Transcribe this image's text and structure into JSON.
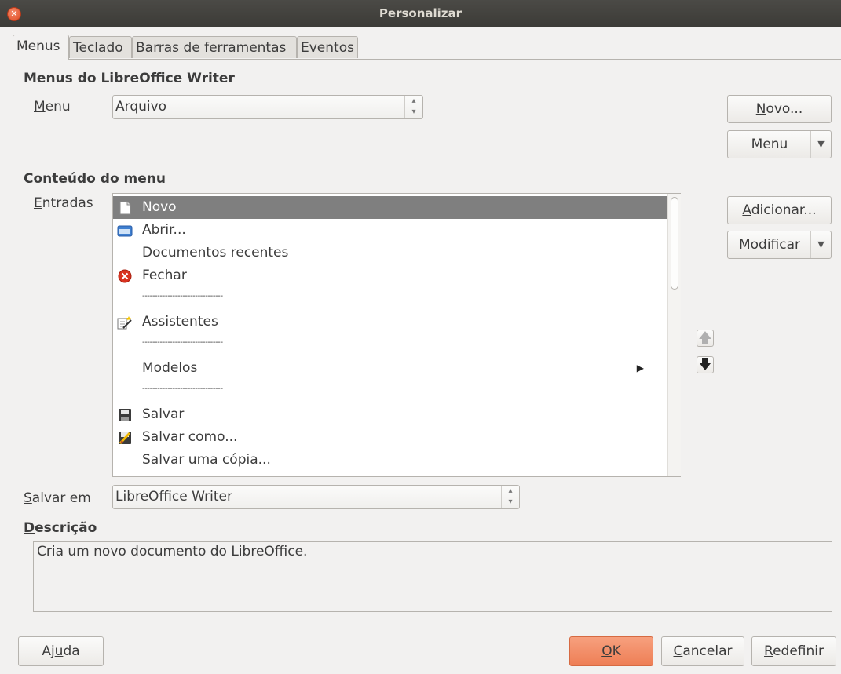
{
  "window": {
    "title": "Personalizar"
  },
  "tabs": [
    {
      "label": "Menus",
      "active": true
    },
    {
      "label": "Teclado",
      "active": false
    },
    {
      "label": "Barras de ferramentas",
      "active": false
    },
    {
      "label": "Eventos",
      "active": false
    }
  ],
  "menus_section": {
    "title": "Menus do LibreOffice Writer",
    "menu_label": "Menu",
    "menu_value": "Arquivo",
    "new_button": "Novo...",
    "menu_button": "Menu"
  },
  "content_section": {
    "title": "Conteúdo do menu",
    "entries_label": "Entradas",
    "entries": [
      {
        "label": "Novo",
        "icon": "new-document-icon",
        "selected": true
      },
      {
        "label": "Abrir...",
        "icon": "open-folder-icon"
      },
      {
        "label": "Documentos recentes",
        "icon": ""
      },
      {
        "label": "Fechar",
        "icon": "close-red-icon"
      },
      {
        "label": "--------------------------------",
        "icon": ""
      },
      {
        "label": "Assistentes",
        "icon": "wizard-icon"
      },
      {
        "label": "--------------------------------",
        "icon": ""
      },
      {
        "label": "Modelos",
        "icon": "",
        "submenu": true
      },
      {
        "label": "--------------------------------",
        "icon": ""
      },
      {
        "label": "Salvar",
        "icon": "save-icon"
      },
      {
        "label": "Salvar como...",
        "icon": "save-as-icon"
      },
      {
        "label": "Salvar uma cópia...",
        "icon": ""
      }
    ],
    "add_button": "Adicionar...",
    "modify_button": "Modificar"
  },
  "save_in": {
    "label": "Salvar em",
    "value": "LibreOffice Writer"
  },
  "description": {
    "title": "Descrição",
    "text": "Cria um novo documento do LibreOffice."
  },
  "footer": {
    "help": "Ajuda",
    "ok": "OK",
    "cancel": "Cancelar",
    "reset": "Redefinir"
  },
  "colors": {
    "ok_accent": "#ee7e55",
    "selection": "#7f7f7f"
  }
}
